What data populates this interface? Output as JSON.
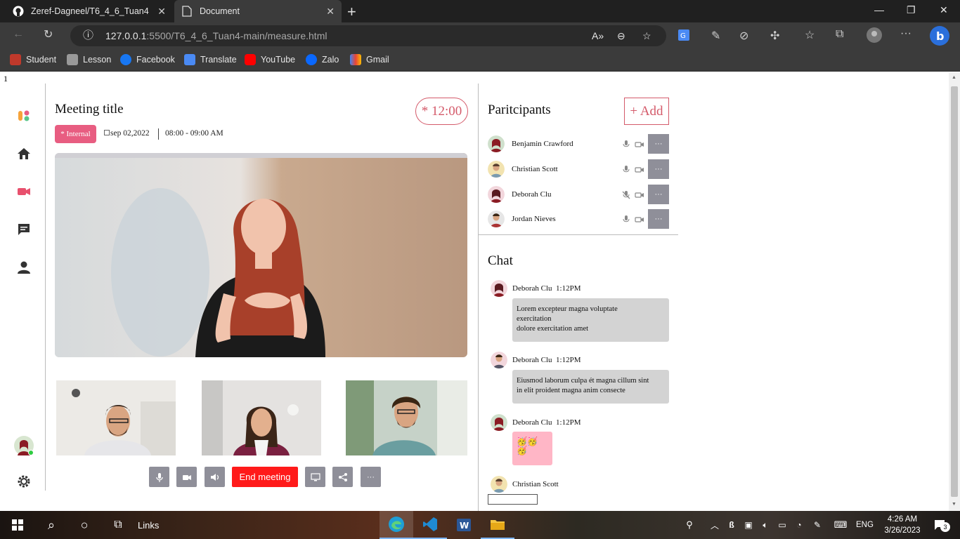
{
  "browser": {
    "tabs": [
      {
        "title": "Zeref-Dagneel/T6_4_6_Tuan4",
        "icon": "github-icon"
      },
      {
        "title": "Document",
        "icon": "document-icon"
      }
    ],
    "url_host": "127.0.0.1",
    "url_path": ":5500/T6_4_6_Tuan4-main/measure.html",
    "bookmarks": [
      "Student",
      "Lesson",
      "Facebook",
      "Translate",
      "YouTube",
      "Zalo",
      "Gmail"
    ]
  },
  "page": {
    "stray_text": "1",
    "meeting": {
      "title": "Meeting title",
      "timer": "* 12:00",
      "tag": "* Internal",
      "date": "sep 02,2022",
      "time_range": "08:00 - 09:00 AM"
    },
    "controls": {
      "end_meeting": "End meeting"
    },
    "participants": {
      "title": "Paritcipants",
      "add_label": "+ Add",
      "list": [
        {
          "name": "Benjamin Crawford",
          "mic_muted": false
        },
        {
          "name": "Christian Scott",
          "mic_muted": false
        },
        {
          "name": "Deborah Clu",
          "mic_muted": true
        },
        {
          "name": "Jordan Nieves",
          "mic_muted": false
        }
      ],
      "more_label": "···"
    },
    "chat": {
      "title": "Chat",
      "messages": [
        {
          "author": "Deborah Clu",
          "time": "1:12PM",
          "line1": "Lorem excepteur magna voluptate",
          "line2": "exercitation",
          "line3": "dolore exercitation amet"
        },
        {
          "author": "Deborah Clu",
          "time": "1:12PM",
          "line1": "Eiusmod laborum culpa ét magna cillum sint",
          "line2": "in elit proident magna anim consecte"
        },
        {
          "author": "Deborah Clu",
          "time": "1:12PM",
          "emoji1": "🥳🥳",
          "emoji2": "🥳"
        },
        {
          "author": "Christian Scott"
        }
      ]
    }
  },
  "taskbar": {
    "links_label": "Links",
    "lang": "ENG",
    "time": "4:26 AM",
    "date": "3/26/2023",
    "notification_count": "3"
  },
  "colors": {
    "accent": "#d45a6a",
    "tag_bg": "#e85d81",
    "end_meeting": "#ff1a1a",
    "control_gray": "#8f8f99"
  }
}
